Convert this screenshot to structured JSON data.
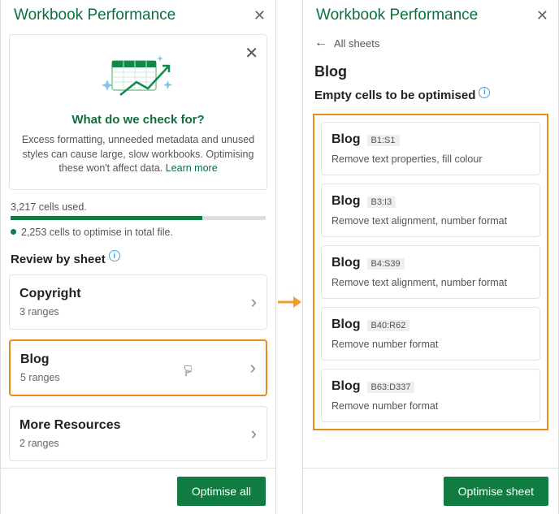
{
  "left": {
    "title": "Workbook Performance",
    "card": {
      "question": "What do we check for?",
      "desc": "Excess formatting, unneeded metadata and unused styles can cause large, slow workbooks. Optimising these won't affect data. ",
      "learn": "Learn more"
    },
    "cellsUsed": "3,217 cells used.",
    "cellsOptim": "2,253 cells to optimise in total file.",
    "review": "Review by sheet",
    "sheets": [
      {
        "name": "Copyright",
        "ranges": "3 ranges"
      },
      {
        "name": "Blog",
        "ranges": "5 ranges"
      },
      {
        "name": "More Resources",
        "ranges": "2 ranges"
      }
    ],
    "button": "Optimise all"
  },
  "right": {
    "title": "Workbook Performance",
    "back": "All sheets",
    "sheetName": "Blog",
    "heading": "Empty cells to be optimised",
    "ranges": [
      {
        "sheet": "Blog",
        "range": "B1:S1",
        "desc": "Remove text properties, fill colour"
      },
      {
        "sheet": "Blog",
        "range": "B3:I3",
        "desc": "Remove text alignment, number format"
      },
      {
        "sheet": "Blog",
        "range": "B4:S39",
        "desc": "Remove text alignment, number format"
      },
      {
        "sheet": "Blog",
        "range": "B40:R62",
        "desc": "Remove number format"
      },
      {
        "sheet": "Blog",
        "range": "B63:D337",
        "desc": "Remove number format"
      }
    ],
    "button": "Optimise sheet"
  }
}
